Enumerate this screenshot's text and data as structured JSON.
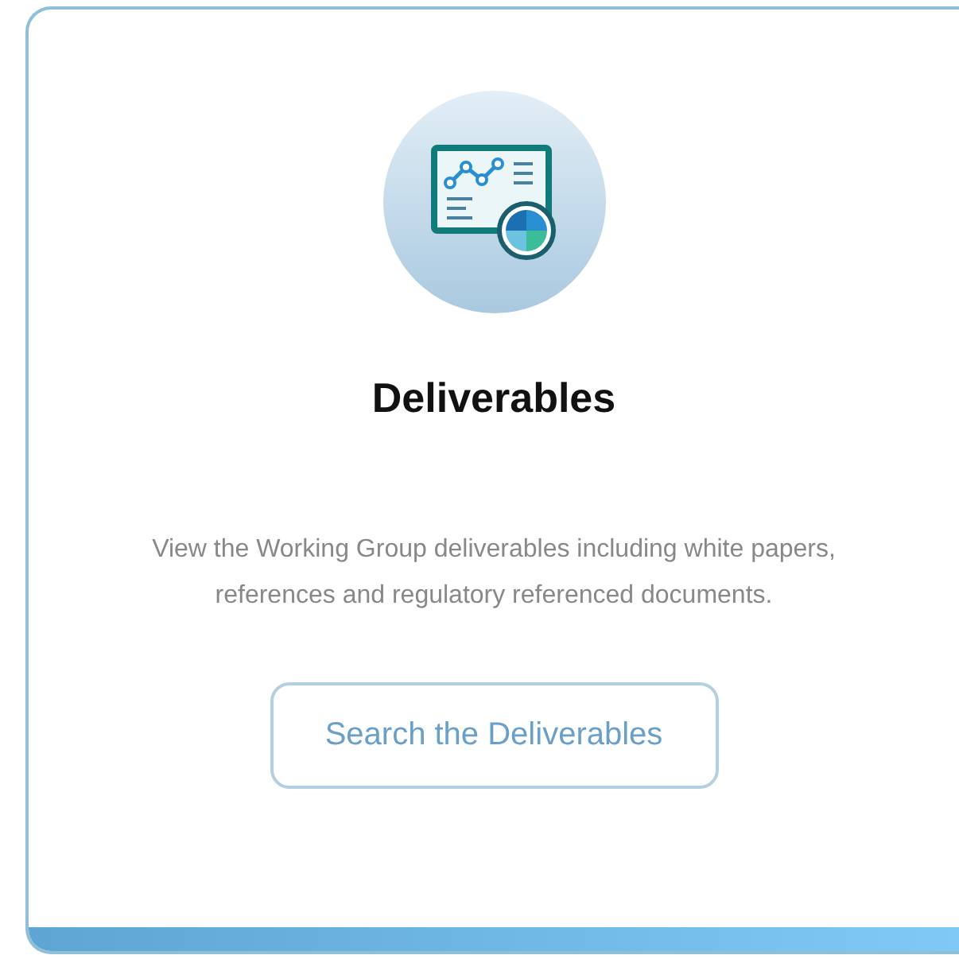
{
  "card": {
    "title": "Deliverables",
    "description": "View the Working Group deliverables including white papers, references and regulatory referenced documents.",
    "button": "Search the Deliverables"
  }
}
